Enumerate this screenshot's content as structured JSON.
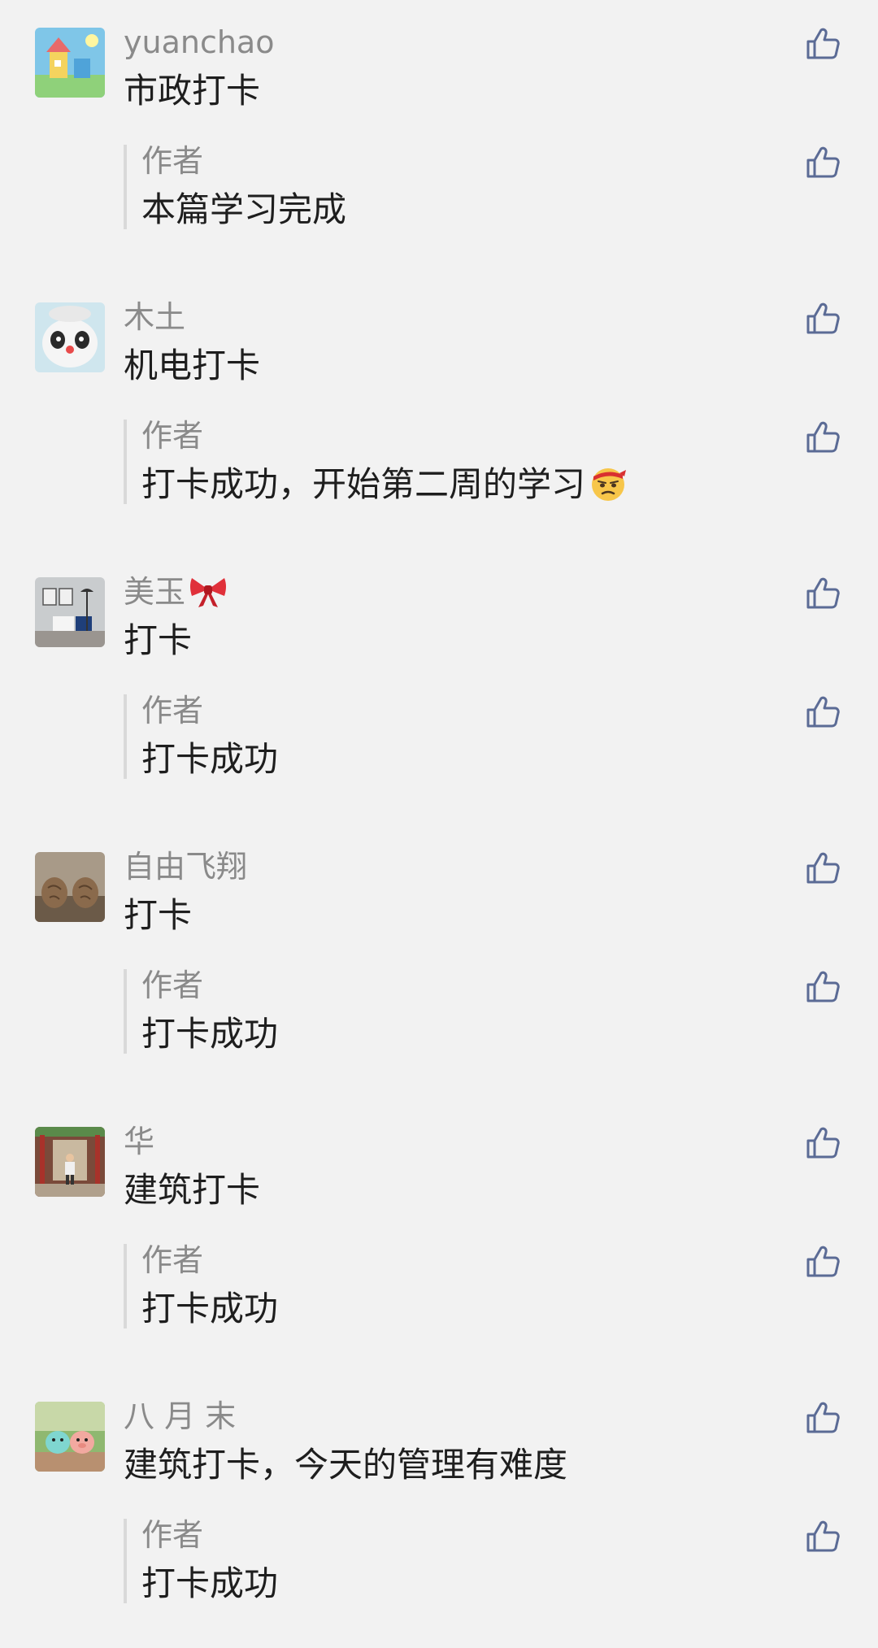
{
  "reply_author_label": "作者",
  "comments": [
    {
      "nickname": "yuanchao",
      "text": "市政打卡",
      "reply": "本篇学习完成",
      "avatar_icon": "children-drawing-avatar"
    },
    {
      "nickname": "木土",
      "text": "机电打卡",
      "reply": "打卡成功，开始第二周的学习",
      "reply_emoji": "frustrated-face-emoji",
      "avatar_icon": "panda-avatar"
    },
    {
      "nickname": "美玉",
      "nickname_emoji": "red-bow-emoji",
      "text": "打卡",
      "reply": "打卡成功",
      "avatar_icon": "interior-room-avatar"
    },
    {
      "nickname": "自由飞翔",
      "text": "打卡",
      "reply": "打卡成功",
      "avatar_icon": "walnuts-avatar"
    },
    {
      "nickname": "华",
      "text": "建筑打卡",
      "reply": "打卡成功",
      "avatar_icon": "corridor-person-avatar"
    },
    {
      "nickname": "八 月 末",
      "text": "建筑打卡，今天的管理有难度",
      "reply": "打卡成功",
      "avatar_icon": "toy-figures-avatar"
    }
  ],
  "colors": {
    "background": "#f2f2f2",
    "nickname": "#8a8a8a",
    "text": "#1e1e1e",
    "like_icon": "#5b6b95"
  }
}
